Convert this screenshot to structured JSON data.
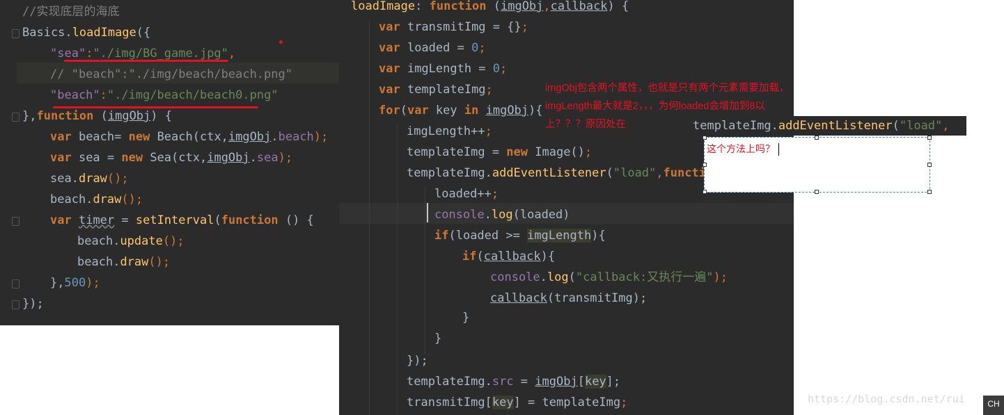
{
  "left_code": {
    "comment": "//实现底层的海底",
    "basics": "Basics",
    "dot1": ".",
    "load_image": "loadImage",
    "open": "({",
    "sea_key": "\"sea\"",
    "colon": ":",
    "sea_val": "\"./img/BG_game.jpg\"",
    "comma": ",",
    "beach_comment": "// \"beach\":\"./img/beach/beach.png\"",
    "beach_key": "\"beach\"",
    "beach_val": "\"./img/beach/beach0.png\"",
    "close_open": "},",
    "function_kw": "function",
    "paren_open": " (",
    "imgobj": "imgObj",
    "paren_close": ") {",
    "var_kw": "var",
    "beach_decl": " beach= ",
    "new_kw": "new",
    "beach_ctor": " Beach(ctx,",
    "dot": ".",
    "beach_prop": "beach",
    "close_semi": ");",
    "sea_decl": " sea = ",
    "sea_ctor": " Sea(ctx,",
    "sea_prop": "sea",
    "sea_obj": "sea",
    "draw": "draw",
    "call_semi": "();",
    "beach_obj": "beach",
    "timer": "timer",
    "eq": " = ",
    "set_interval": "setInterval",
    "paren": "(",
    "fn_tail": " () {",
    "update": "update",
    "interval_close": "},",
    "interval_num": "500",
    "end_interval": ");",
    "end_all": "});"
  },
  "right_code": {
    "load_image": "loadImage",
    "colon": ": ",
    "function_kw": "function",
    "sig_open": " (",
    "imgobj": "imgObj",
    "comma": ",",
    "callback": "callback",
    "sig_close": ") {",
    "var_kw": "var",
    "transmit_decl": " transmitImg = {}",
    "semi": ";",
    "loaded_decl": " loaded = ",
    "zero": "0",
    "imglength_decl": " imgLength = ",
    "template_decl": " templateImg",
    "for_kw": "for",
    "for_open": "(",
    "key_txt": " key ",
    "in_kw": "in",
    "space": " ",
    "for_close": "){",
    "imglength_inc": "imgLength++",
    "template_assign": "templateImg = ",
    "new_kw": "new",
    "image_ctor": " Image()",
    "template_obj": "templateImg",
    "dot": ".",
    "add_listener": "addEventListener",
    "load_str": "\"load\"",
    "fn_tail": " () {",
    "loaded_inc": "loaded++",
    "console_obj": "console",
    "log_fn": "log",
    "log_loaded": "(loaded)",
    "if_kw": "if",
    "if_cond": "(loaded >= ",
    "imglength": "imgLength",
    "if_close": "){",
    "cb_open": "(",
    "console_log_str": "\"callback:又执行一遍\"",
    "cb_close": ");",
    "cb_call_args": "(transmitImg);",
    "brace": "}",
    "close_listener": "});",
    "src_prop": "src",
    "src_eq": " = ",
    "lbracket": "[",
    "key": "key",
    "rbracket_semi": "];",
    "transmit_obj": "transmitImg",
    "rbracket_assign": "] = templateImg",
    "template_img_overlay": "templateImg",
    "overlay_paren": "(",
    "overlay_str": "\"load\"",
    "overlay_tail": ",",
    "overlay_comma": ","
  },
  "annotation": {
    "question": "imgObj包含两个属性，也就是只有两个元素需要加载，imgLength最大就是2，，，为何loaded会增加到8以上？？？原因处在",
    "box_text": "这个方法上吗？"
  },
  "watermark": "https://blog.csdn.net/rui",
  "corner_badge": "CH",
  "colors": {
    "editor_bg": "#2b2b2b",
    "keyword": "#cc7832",
    "function": "#ffc66d",
    "string": "#6a8759",
    "property": "#9876aa",
    "number": "#6897bb",
    "comment": "#808080",
    "annotation_red": "#e81123"
  }
}
